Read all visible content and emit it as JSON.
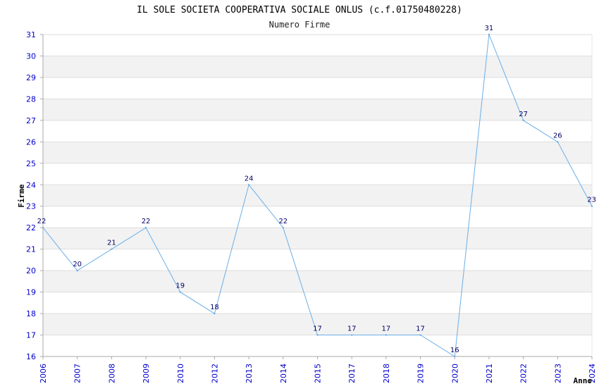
{
  "chart_data": {
    "type": "line",
    "title": "IL SOLE SOCIETA COOPERATIVA SOCIALE ONLUS (c.f.01750480228)",
    "subtitle": "Numero Firme",
    "xlabel": "Anno",
    "ylabel": "Firme",
    "x": [
      "2006",
      "2007",
      "2008",
      "2009",
      "2010",
      "2012",
      "2013",
      "2014",
      "2015",
      "2017",
      "2018",
      "2019",
      "2020",
      "2021",
      "2022",
      "2023",
      "2024"
    ],
    "values": [
      22,
      20,
      21,
      22,
      19,
      18,
      24,
      22,
      17,
      17,
      17,
      17,
      16,
      31,
      27,
      26,
      23
    ],
    "ylim": [
      16,
      31
    ],
    "yticks": [
      "16",
      "17",
      "18",
      "19",
      "20",
      "21",
      "22",
      "23",
      "24",
      "25",
      "26",
      "27",
      "28",
      "29",
      "30",
      "31"
    ],
    "grid": "horizontal bands",
    "colors": {
      "line": "#6aaee8",
      "band": "#f2f2f2",
      "gridline": "#dddddd",
      "axis": "#aaaaaa",
      "tick_label": "#0000cc",
      "data_label": "#000066"
    }
  }
}
